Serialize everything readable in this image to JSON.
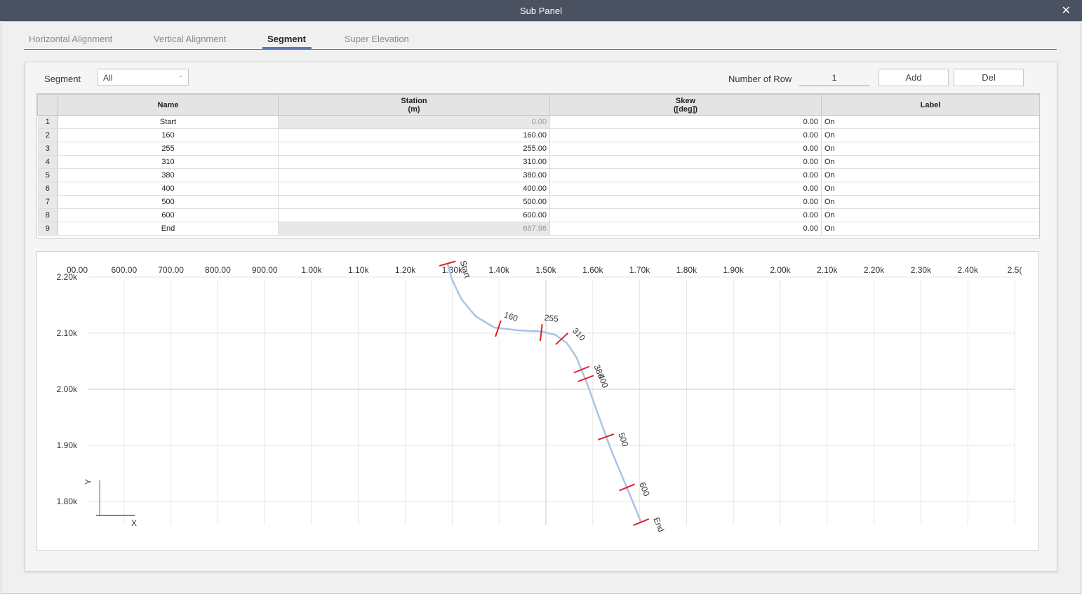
{
  "window": {
    "title": "Sub Panel",
    "close_glyph": "✕"
  },
  "tabs": [
    {
      "label": "Horizontal Alignment",
      "active": false
    },
    {
      "label": "Vertical Alignment",
      "active": false
    },
    {
      "label": "Segment",
      "active": true
    },
    {
      "label": "Super Elevation",
      "active": false
    }
  ],
  "filter": {
    "label": "Segment",
    "selected": "All"
  },
  "rows_control": {
    "label": "Number of Row",
    "value": "1",
    "add_label": "Add",
    "del_label": "Del"
  },
  "table": {
    "headers": {
      "name": "Name",
      "station_line1": "Station",
      "station_line2": "(m)",
      "skew_line1": "Skew",
      "skew_line2": "([deg])",
      "label": "Label"
    },
    "rows": [
      {
        "n": "1",
        "name": "Start",
        "station": "0.00",
        "skew": "0.00",
        "label": "On"
      },
      {
        "n": "2",
        "name": "160",
        "station": "160.00",
        "skew": "0.00",
        "label": "On"
      },
      {
        "n": "3",
        "name": "255",
        "station": "255.00",
        "skew": "0.00",
        "label": "On"
      },
      {
        "n": "4",
        "name": "310",
        "station": "310.00",
        "skew": "0.00",
        "label": "On"
      },
      {
        "n": "5",
        "name": "380",
        "station": "380.00",
        "skew": "0.00",
        "label": "On"
      },
      {
        "n": "6",
        "name": "400",
        "station": "400.00",
        "skew": "0.00",
        "label": "On"
      },
      {
        "n": "7",
        "name": "500",
        "station": "500.00",
        "skew": "0.00",
        "label": "On"
      },
      {
        "n": "8",
        "name": "600",
        "station": "600.00",
        "skew": "0.00",
        "label": "On"
      },
      {
        "n": "9",
        "name": "End",
        "station": "687.96",
        "skew": "0.00",
        "label": "On"
      }
    ]
  },
  "chart_data": {
    "type": "line",
    "x_ticks": [
      {
        "v": 500,
        "t": "00.00"
      },
      {
        "v": 600,
        "t": "600.00"
      },
      {
        "v": 700,
        "t": "700.00"
      },
      {
        "v": 800,
        "t": "800.00"
      },
      {
        "v": 900,
        "t": "900.00"
      },
      {
        "v": 1000,
        "t": "1.00k"
      },
      {
        "v": 1100,
        "t": "1.10k"
      },
      {
        "v": 1200,
        "t": "1.20k"
      },
      {
        "v": 1300,
        "t": "1.30k"
      },
      {
        "v": 1400,
        "t": "1.40k"
      },
      {
        "v": 1500,
        "t": "1.50k"
      },
      {
        "v": 1600,
        "t": "1.60k"
      },
      {
        "v": 1700,
        "t": "1.70k"
      },
      {
        "v": 1800,
        "t": "1.80k"
      },
      {
        "v": 1900,
        "t": "1.90k"
      },
      {
        "v": 2000,
        "t": "2.00k"
      },
      {
        "v": 2100,
        "t": "2.10k"
      },
      {
        "v": 2200,
        "t": "2.20k"
      },
      {
        "v": 2300,
        "t": "2.30k"
      },
      {
        "v": 2400,
        "t": "2.40k"
      },
      {
        "v": 2500,
        "t": "2.5("
      }
    ],
    "y_ticks": [
      {
        "v": 2200,
        "t": "2.20k"
      },
      {
        "v": 2100,
        "t": "2.10k"
      },
      {
        "v": 2000,
        "t": "2.00k"
      },
      {
        "v": 1900,
        "t": "1.90k"
      },
      {
        "v": 1800,
        "t": "1.80k"
      }
    ],
    "xlim": [
      500,
      2500
    ],
    "ylim": [
      1750,
      2230
    ],
    "axis_labels": {
      "x": "X",
      "y": "Y"
    },
    "alignment_color": "#a8c4e6",
    "marker_color": "#e0202a",
    "alignment": [
      [
        1290,
        2224
      ],
      [
        1300,
        2195
      ],
      [
        1320,
        2160
      ],
      [
        1350,
        2130
      ],
      [
        1390,
        2110
      ],
      [
        1440,
        2105
      ],
      [
        1490,
        2103
      ],
      [
        1520,
        2097
      ],
      [
        1545,
        2082
      ],
      [
        1565,
        2057
      ],
      [
        1578,
        2030
      ],
      [
        1588,
        2010
      ],
      [
        1605,
        1970
      ],
      [
        1620,
        1935
      ],
      [
        1640,
        1890
      ],
      [
        1665,
        1840
      ],
      [
        1690,
        1790
      ],
      [
        1703,
        1763
      ]
    ],
    "stations": [
      {
        "name": "Start",
        "x": 1290,
        "y": 2224
      },
      {
        "name": "160",
        "x": 1398,
        "y": 2108
      },
      {
        "name": "255",
        "x": 1490,
        "y": 2101
      },
      {
        "name": "310",
        "x": 1534,
        "y": 2090
      },
      {
        "name": "380",
        "x": 1576,
        "y": 2035
      },
      {
        "name": "400",
        "x": 1585,
        "y": 2019
      },
      {
        "name": "500",
        "x": 1628,
        "y": 1915
      },
      {
        "name": "600",
        "x": 1673,
        "y": 1825
      },
      {
        "name": "End",
        "x": 1703,
        "y": 1763
      }
    ]
  }
}
